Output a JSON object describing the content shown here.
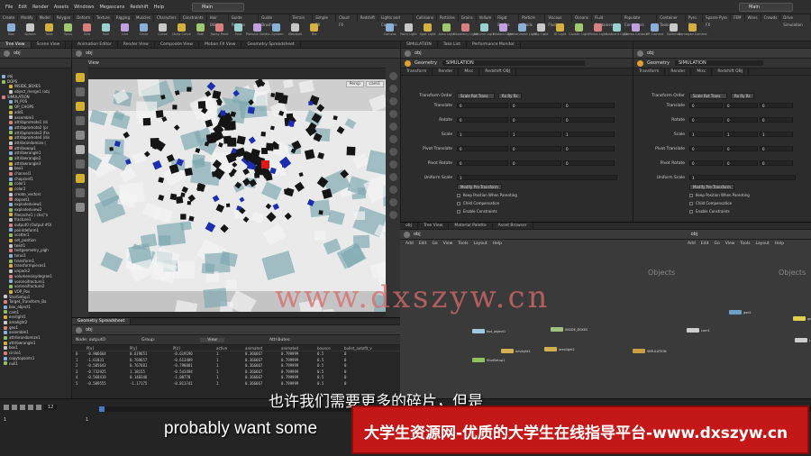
{
  "menu": {
    "items": [
      "File",
      "Edit",
      "Render",
      "Assets",
      "Windows",
      "Megascans",
      "Redshift",
      "Help"
    ],
    "desktop": "Main",
    "desktop_right": "Main",
    "build": "UHD"
  },
  "shelf_left": {
    "tabs": [
      "Create",
      "Modify",
      "Model",
      "Polygon",
      "Deform",
      "Texture",
      "Rigging",
      "Muscles",
      "Characters",
      "Constraints",
      "Hair Utils",
      "Guide Process",
      "Guide Brushes",
      "Terrain FX",
      "Simple FX",
      "Cloud FX",
      "Redshift"
    ],
    "tools": [
      "Box",
      "Sphere",
      "Tube",
      "Torus",
      "Grid",
      "Null",
      "Line",
      "Circle",
      "Curve",
      "Draw Curve",
      "Path",
      "Spray Paint",
      "Font",
      "Platonic Solids",
      "L-System",
      "Metaball",
      "File"
    ]
  },
  "shelf_right": {
    "tabs": [
      "Lights and Cameras",
      "Collisions",
      "Particles",
      "Grains",
      "Vellum",
      "Rigid Bodies",
      "Particle Fluids",
      "Viscous Fluids",
      "Oceans",
      "Fluid Containers",
      "Populate Containers",
      "Container Tools",
      "Pyro FX",
      "Sparse Pyro FX",
      "FEM",
      "Wires",
      "Crowds",
      "Drive Simulation"
    ],
    "tools": [
      "Camera",
      "Point Light",
      "Spot Light",
      "Area Light",
      "Geometry Light",
      "Volume Light",
      "Distant Light",
      "Environment Light",
      "Sky Light",
      "GI Light",
      "Caustic Light",
      "Portal Light",
      "Ambient Light",
      "Stereo Camera",
      "VR Camera",
      "Switcher",
      "Gamepad Camera"
    ]
  },
  "tree_pane": {
    "tabs": [
      "Tree View",
      "Scene View"
    ],
    "path": "obj",
    "items": [
      "obj",
      "DOPS",
      "INSIDE_BOXES",
      "object_merge1 (obj",
      "SIMULATION",
      "IN_POS",
      "OP_CHOPS",
      "add1",
      "assemble1",
      "attribpromote1 (di",
      "attribpromote2 (pr",
      "attribpromote3 (fra",
      "attribpromote4 (dis",
      "attribrandomize (",
      "attribswap1",
      "attribwrangle1",
      "attribwrangle2",
      "attribwrangle3",
      "box1",
      "channel1",
      "chopsnet1",
      "color1",
      "color2",
      "create_vectors",
      "dopnet1",
      "explodedview1",
      "explodedview2",
      "filecache1 ( chs(\"n",
      "fracture1",
      "output0 (Output #0)",
      "pointdeform1",
      "scatter1",
      "set_position",
      "twist1",
      "testgeometry_pigh",
      "torus1",
      "transform1",
      "transformpieces1",
      "unpack2",
      "volumenoisydegree1",
      "voronoifracture1",
      "voronoifracture2",
      "VOP_Pos",
      "ShotSetup1",
      "Target_Transform_Ba",
      "box_object1",
      "cam1",
      "envlight1",
      "arealight2",
      "geo1",
      "assemble1",
      "attribrandomize1",
      "attribwrangle1",
      "box1",
      "circle1",
      "copytopoints1",
      "null1"
    ]
  },
  "scene_view": {
    "tabs": [
      "Animation Editor",
      "Render View",
      "Composite View",
      "Motion FX View",
      "Geometry Spreadsheet"
    ],
    "path": "obj",
    "label": "View",
    "persp": "Persp",
    "cam": "cam1"
  },
  "spreadsheet": {
    "tab": "Geometry Spreadsheet",
    "path": "obj",
    "node": "Node: outputO",
    "group": "Group:",
    "view": "View",
    "attributes": "Attributes:",
    "columns": [
      "",
      "P[x]",
      "P[y]",
      "P[z]",
      "active",
      "animated",
      "animated",
      "bounce",
      "bullet_autofit_v"
    ],
    "rows": [
      [
        "0",
        "-0.906664",
        "0.619651",
        "-0.619190",
        "1",
        "0.366667",
        "0.799999",
        "0.5",
        "0"
      ],
      [
        "1",
        "-1.61831",
        "0.769657",
        "-0.613489",
        "1",
        "0.366667",
        "0.799999",
        "0.5",
        "0"
      ],
      [
        "2",
        "-0.505643",
        "0.767681",
        "-0.798881",
        "1",
        "0.366667",
        "0.799999",
        "0.5",
        "0"
      ],
      [
        "3",
        "-0.732925",
        "1.18155",
        "-0.543494",
        "1",
        "0.366667",
        "0.799999",
        "0.5",
        "0"
      ],
      [
        "4",
        "-0.568419",
        "0.148346",
        "-1.00778",
        "1",
        "0.366667",
        "0.799999",
        "0.5",
        "0"
      ],
      [
        "5",
        "-0.509555",
        "-1.17175",
        "-0.811741",
        "1",
        "0.366667",
        "0.799999",
        "0.5",
        "0"
      ]
    ]
  },
  "param_left": {
    "tabs": [
      "SIMULATION",
      "Take List",
      "Performance Monitor"
    ],
    "path": "obj",
    "type": "Geometry",
    "name": "SIMULATION",
    "subtabs": [
      "Transform",
      "Render",
      "Misc",
      "Redshift OBJ"
    ],
    "transform_order_label": "Transform Order",
    "transform_order": "Scale Rot Trans",
    "rot_order": "Rx Ry Rz",
    "params": [
      {
        "label": "Translate",
        "v": [
          "0",
          "0",
          "0"
        ]
      },
      {
        "label": "Rotate",
        "v": [
          "0",
          "0",
          "0"
        ]
      },
      {
        "label": "Scale",
        "v": [
          "1",
          "1",
          "1"
        ]
      },
      {
        "label": "Pivot Translate",
        "v": [
          "0",
          "0",
          "0"
        ]
      },
      {
        "label": "Pivot Rotate",
        "v": [
          "0",
          "0",
          "0"
        ]
      }
    ],
    "uniform_label": "Uniform Scale",
    "uniform": "1",
    "modify_btn": "Modify Pre-Transform",
    "checks": [
      "Keep Position When Parenting",
      "Child Compensation",
      "Enable Constraints"
    ]
  },
  "param_right": {
    "path": "obj",
    "type": "Geometry",
    "name": "SIMULATION",
    "subtabs": [
      "Transform",
      "Render",
      "Misc",
      "Redshift OBJ"
    ],
    "transform_order_label": "Transform Order",
    "transform_order": "Scale Rot Trans",
    "rot_order": "Rx Ry Rz",
    "params": [
      {
        "label": "Translate",
        "v": [
          "0",
          "0",
          "0"
        ]
      },
      {
        "label": "Rotate",
        "v": [
          "0",
          "0",
          "0"
        ]
      },
      {
        "label": "Scale",
        "v": [
          "1",
          "1",
          "1"
        ]
      },
      {
        "label": "Pivot Translate",
        "v": [
          "0",
          "0",
          "0"
        ]
      },
      {
        "label": "Pivot Rotate",
        "v": [
          "0",
          "0",
          "0"
        ]
      }
    ],
    "uniform_label": "Uniform Scale",
    "uniform": "1",
    "modify_btn": "Modify Pre-Transform",
    "checks": [
      "Keep Position When Parenting",
      "Child Compensation",
      "Enable Constraints"
    ]
  },
  "network": {
    "tabs": [
      "obj",
      "Tree View",
      "Material Palette",
      "Asset Browser"
    ],
    "path": "obj",
    "path_right": "obj",
    "menu": [
      "Add",
      "Edit",
      "Go",
      "View",
      "Tools",
      "Layout",
      "Help"
    ],
    "objects_label": "Objects",
    "nodes": [
      {
        "name": "geo1",
        "color": "#6ca0c8"
      },
      {
        "name": "cam1",
        "color": "#cccccc"
      },
      {
        "name": "envlight1",
        "color": "#d4b050"
      },
      {
        "name": "arealight2",
        "color": "#d4b050"
      },
      {
        "name": "box_object1",
        "color": "#a0c8e0"
      },
      {
        "name": "INSIDE_BOXES",
        "color": "#a0c080"
      },
      {
        "name": "SIMULATION",
        "color": "#c8a040"
      },
      {
        "name": "ShotSetup1",
        "color": "#90c060"
      },
      {
        "name": "geo1",
        "color": "#e0d050"
      },
      {
        "name": "cam1",
        "color": "#cccccc"
      }
    ]
  },
  "timeline": {
    "frame": "12",
    "start": "1",
    "end": "1"
  },
  "overlay": {
    "subtitle_cn": "也许我们需要更多的碎片，但是",
    "subtitle_en": "probably want some",
    "banner": "大学生资源网-优质的大学生在线指导平台-www.dxszyw.cn",
    "watermark": "www.dxszyw.cn"
  }
}
